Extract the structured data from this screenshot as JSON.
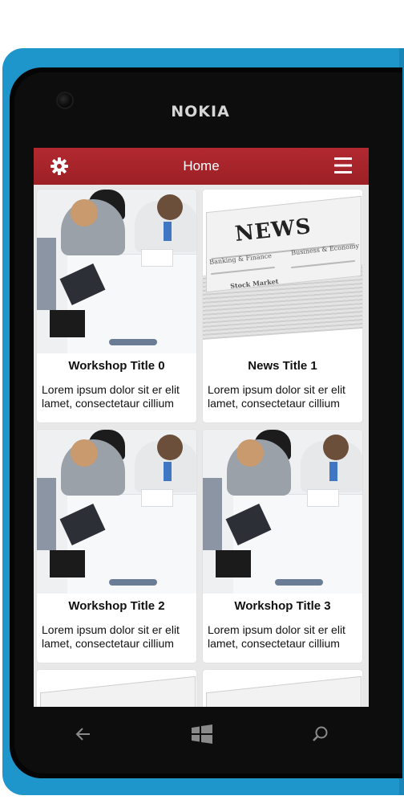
{
  "device": {
    "brand": "NOKIA"
  },
  "appbar": {
    "title": "Home"
  },
  "cards": [
    {
      "title": "Workshop Title 0",
      "description": "Lorem ipsum dolor sit er elit lamet, consectetaur cillium",
      "image": "workshop-photo"
    },
    {
      "title": "News Title 1",
      "description": "Lorem ipsum dolor sit er elit lamet, consectetaur cillium",
      "image": "news-photo"
    },
    {
      "title": "Workshop Title 2",
      "description": "Lorem ipsum dolor sit er elit lamet, consectetaur cillium",
      "image": "workshop-photo"
    },
    {
      "title": "Workshop Title 3",
      "description": "Lorem ipsum dolor sit er elit lamet, consectetaur cillium",
      "image": "workshop-photo"
    }
  ],
  "news_image_text": {
    "headline": "NEWS",
    "section_a": "Banking & Finance",
    "section_b": "Business & Economy",
    "section_c": "Stock Market"
  },
  "colors": {
    "accent": "#a5242b",
    "phone_body": "#1e96cc"
  },
  "icons": {
    "appbar_left": "gear-icon",
    "appbar_right": "hamburger-menu-icon",
    "nav_left": "back-arrow-icon",
    "nav_center": "windows-logo-icon",
    "nav_right": "search-icon"
  }
}
